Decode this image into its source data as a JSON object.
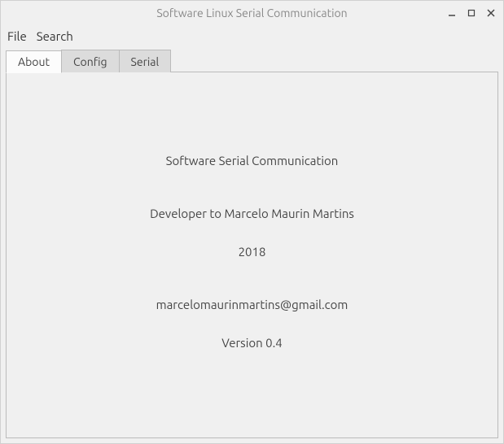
{
  "window": {
    "title": "Software Linux Serial Communication"
  },
  "menubar": {
    "file": "File",
    "search": "Search"
  },
  "tabs": {
    "about": "About",
    "config": "Config",
    "serial": "Serial"
  },
  "about": {
    "title": "Software Serial Communication",
    "developer": "Developer to Marcelo Maurin Martins",
    "year": "2018",
    "email": "marcelomaurinmartins@gmail.com",
    "version": "Version 0.4"
  }
}
